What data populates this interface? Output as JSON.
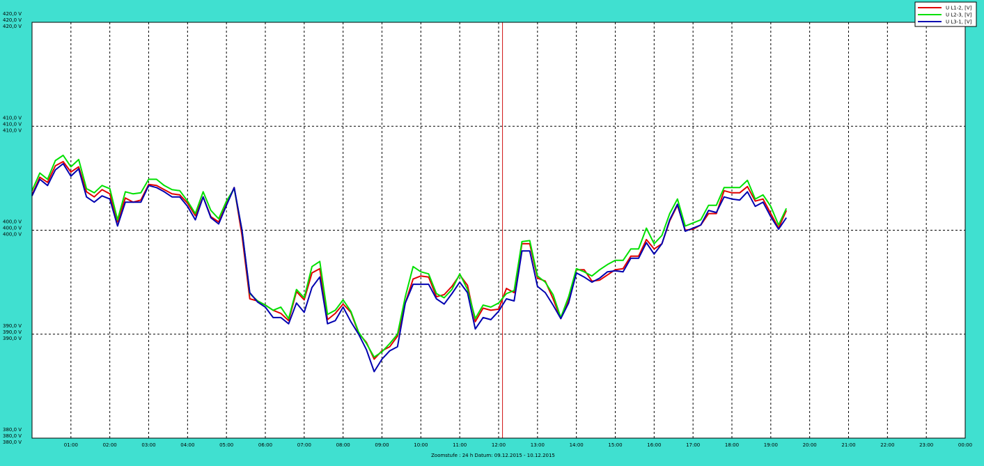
{
  "chart_data": {
    "type": "line",
    "ylim": [
      380,
      420
    ],
    "xlim_hours": [
      0,
      24
    ],
    "y_ticks": [
      {
        "value": 420,
        "labels": [
          "420,0 V",
          "420,0 V",
          "420,0 V"
        ]
      },
      {
        "value": 410,
        "labels": [
          "410,0 V",
          "410,0 V",
          "410,0 V"
        ]
      },
      {
        "value": 400,
        "labels": [
          "400,0 V",
          "400,0 V",
          "400,0 V"
        ]
      },
      {
        "value": 390,
        "labels": [
          "390,0 V",
          "390,0 V",
          "390,0 V"
        ]
      },
      {
        "value": 380,
        "labels": [
          "380,0 V",
          "380,0 V",
          "380,0 V"
        ]
      }
    ],
    "x_ticks": [
      {
        "value": 1,
        "label": "01:00"
      },
      {
        "value": 2,
        "label": "02:00"
      },
      {
        "value": 3,
        "label": "03:00"
      },
      {
        "value": 4,
        "label": "04:00"
      },
      {
        "value": 5,
        "label": "05:00"
      },
      {
        "value": 6,
        "label": "06:00"
      },
      {
        "value": 7,
        "label": "07:00"
      },
      {
        "value": 8,
        "label": "08:00"
      },
      {
        "value": 9,
        "label": "09:00"
      },
      {
        "value": 10,
        "label": "10:00"
      },
      {
        "value": 11,
        "label": "11:00"
      },
      {
        "value": 12,
        "label": "12:00"
      },
      {
        "value": 13,
        "label": "13:00"
      },
      {
        "value": 14,
        "label": "14:00"
      },
      {
        "value": 15,
        "label": "15:00"
      },
      {
        "value": 16,
        "label": "16:00"
      },
      {
        "value": 17,
        "label": "17:00"
      },
      {
        "value": 18,
        "label": "18:00"
      },
      {
        "value": 19,
        "label": "19:00"
      },
      {
        "value": 20,
        "label": "20:00"
      },
      {
        "value": 21,
        "label": "21:00"
      },
      {
        "value": 22,
        "label": "22:00"
      },
      {
        "value": 23,
        "label": "23:00"
      },
      {
        "value": 24,
        "label": "00:00"
      }
    ],
    "grid": true,
    "legend_position": "top-right",
    "cursor_x": 12.1,
    "x": [
      0,
      0.2,
      0.4,
      0.6,
      0.8,
      1.0,
      1.2,
      1.4,
      1.6,
      1.8,
      2.0,
      2.2,
      2.4,
      2.6,
      2.8,
      3.0,
      3.2,
      3.4,
      3.6,
      3.8,
      4.0,
      4.2,
      4.4,
      4.6,
      4.8,
      5.0,
      5.2,
      5.4,
      5.6,
      5.8,
      6.0,
      6.2,
      6.4,
      6.6,
      6.8,
      7.0,
      7.2,
      7.4,
      7.6,
      7.8,
      8.0,
      8.2,
      8.4,
      8.6,
      8.8,
      9.0,
      9.2,
      9.4,
      9.6,
      9.8,
      10.0,
      10.2,
      10.4,
      10.6,
      10.8,
      11.0,
      11.2,
      11.4,
      11.6,
      11.8,
      12.0,
      12.2,
      12.4,
      12.6,
      12.8,
      13.0,
      13.2,
      13.4,
      13.6,
      13.8,
      14.0,
      14.2,
      14.4,
      14.6,
      14.8,
      15.0,
      15.2,
      15.4,
      15.6,
      15.8,
      16.0,
      16.2,
      16.4,
      16.6,
      16.8,
      17.0,
      17.2,
      17.4,
      17.6,
      17.8,
      18.0,
      18.2,
      18.4,
      18.6,
      18.8,
      19.0,
      19.2,
      19.4,
      19.6,
      19.8,
      20.0,
      20.2,
      20.4,
      20.6,
      20.8,
      21.0,
      21.2,
      21.4,
      21.6,
      21.8,
      22.0,
      22.2,
      22.4,
      22.6,
      22.8,
      23.0,
      23.2,
      23.4,
      23.6,
      23.8,
      24.0
    ],
    "series": [
      {
        "name": "U L1-2, [V]",
        "color": "#e00000",
        "values": [
          403.4,
          405.1,
          404.6,
          406.2,
          406.6,
          405.6,
          406.1,
          403.7,
          403.2,
          403.9,
          403.5,
          400.8,
          403.1,
          402.7,
          402.9,
          404.4,
          404.3,
          403.9,
          403.5,
          403.4,
          402.6,
          401.4,
          403.2,
          401.3,
          400.8,
          402.5,
          404.1,
          399.5,
          393.4,
          393.2,
          392.8,
          392.3,
          392.0,
          391.3,
          394.1,
          393.3,
          395.9,
          396.3,
          391.4,
          392.0,
          392.9,
          392.1,
          390.1,
          389.2,
          387.6,
          388.4,
          388.8,
          389.8,
          393.0,
          395.3,
          395.6,
          395.5,
          393.6,
          393.8,
          394.6,
          395.7,
          394.7,
          391.2,
          392.5,
          392.3,
          392.4,
          394.4,
          394.0,
          398.7,
          398.7,
          395.4,
          395.1,
          393.4,
          391.5,
          393.3,
          396.2,
          396.2,
          395.1,
          395.2,
          395.7,
          396.2,
          396.3,
          397.5,
          397.5,
          399.1,
          398.2,
          398.7,
          400.9,
          402.4,
          400.0,
          400.1,
          400.5,
          401.6,
          401.6,
          403.8,
          403.6,
          403.6,
          404.2,
          402.8,
          403.0,
          401.6,
          400.2,
          401.9
        ]
      },
      {
        "name": "U L2-3, [V]",
        "color": "#00e000",
        "values": [
          403.8,
          405.5,
          404.9,
          406.7,
          407.2,
          406.1,
          406.8,
          404.0,
          403.6,
          404.3,
          404.0,
          401.0,
          403.7,
          403.5,
          403.6,
          404.9,
          404.9,
          404.3,
          403.9,
          403.8,
          402.8,
          401.6,
          403.7,
          401.9,
          401.1,
          402.8,
          404.0,
          400.0,
          393.9,
          393.2,
          392.8,
          392.3,
          392.6,
          391.5,
          394.3,
          393.5,
          396.5,
          397.0,
          391.9,
          392.3,
          393.3,
          392.2,
          390.2,
          389.1,
          387.8,
          388.3,
          389.1,
          390.0,
          393.6,
          396.5,
          396.0,
          395.8,
          393.9,
          393.5,
          394.3,
          395.8,
          394.3,
          391.5,
          392.8,
          392.6,
          393.0,
          393.9,
          394.2,
          398.9,
          399.0,
          395.6,
          395.0,
          393.8,
          391.6,
          393.6,
          396.3,
          396.0,
          395.6,
          396.2,
          396.7,
          397.1,
          397.1,
          398.2,
          398.2,
          400.2,
          398.7,
          399.5,
          401.6,
          403.0,
          400.4,
          400.7,
          401.0,
          402.4,
          402.4,
          404.1,
          404.1,
          404.1,
          404.8,
          403.0,
          403.4,
          402.3,
          400.5,
          402.1
        ]
      },
      {
        "name": "U L3-1, [V]",
        "color": "#0000b0",
        "values": [
          403.3,
          404.9,
          404.3,
          405.8,
          406.4,
          405.2,
          405.9,
          403.2,
          402.7,
          403.3,
          403.0,
          400.4,
          402.7,
          402.7,
          402.7,
          404.3,
          404.1,
          403.7,
          403.2,
          403.2,
          402.3,
          401.0,
          403.2,
          401.2,
          400.6,
          402.4,
          404.1,
          400.0,
          394.0,
          393.1,
          392.6,
          391.6,
          391.6,
          391.0,
          393.0,
          392.1,
          394.5,
          395.5,
          391.0,
          391.3,
          392.6,
          391.2,
          390.0,
          388.5,
          386.4,
          387.6,
          388.4,
          388.8,
          393.0,
          394.8,
          394.8,
          394.8,
          393.4,
          392.9,
          393.9,
          395.0,
          394.0,
          390.5,
          391.6,
          391.4,
          392.2,
          393.4,
          393.2,
          398.0,
          398.0,
          394.6,
          394.0,
          392.8,
          391.5,
          393.0,
          395.9,
          395.5,
          395.0,
          395.4,
          396.0,
          396.1,
          396.0,
          397.3,
          397.3,
          398.8,
          397.7,
          398.7,
          401.0,
          402.5,
          399.9,
          400.2,
          400.5,
          401.9,
          401.7,
          403.2,
          403.0,
          402.9,
          403.7,
          402.3,
          402.7,
          401.3,
          400.1,
          401.2
        ]
      }
    ],
    "footer": "Zoomstufe : 24 h   Datum: 09.12.2015  -  10.12.2015"
  }
}
